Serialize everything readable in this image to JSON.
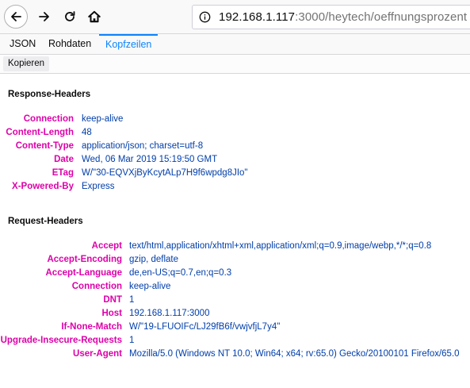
{
  "browser": {
    "url_host": "192.168.1.117",
    "url_rest": ":3000/heytech/oeffnungsprozent"
  },
  "viewer": {
    "tabs": [
      "JSON",
      "Rohdaten",
      "Kopfzeilen"
    ],
    "active_tab": "Kopfzeilen",
    "toolbar": {
      "copy_label": "Kopieren"
    }
  },
  "response_headers": {
    "title": "Response-Headers",
    "items": [
      {
        "name": "Connection",
        "value": "keep-alive"
      },
      {
        "name": "Content-Length",
        "value": "48"
      },
      {
        "name": "Content-Type",
        "value": "application/json; charset=utf-8"
      },
      {
        "name": "Date",
        "value": "Wed, 06 Mar 2019 15:19:50 GMT"
      },
      {
        "name": "ETag",
        "value": "W/\"30-EQVXjByKcytALp7H9f6wpdg8JIo\""
      },
      {
        "name": "X-Powered-By",
        "value": "Express"
      }
    ]
  },
  "request_headers": {
    "title": "Request-Headers",
    "items": [
      {
        "name": "Accept",
        "value": "text/html,application/xhtml+xml,application/xml;q=0.9,image/webp,*/*;q=0.8"
      },
      {
        "name": "Accept-Encoding",
        "value": "gzip, deflate"
      },
      {
        "name": "Accept-Language",
        "value": "de,en-US;q=0.7,en;q=0.3"
      },
      {
        "name": "Connection",
        "value": "keep-alive"
      },
      {
        "name": "DNT",
        "value": "1"
      },
      {
        "name": "Host",
        "value": "192.168.1.117:3000"
      },
      {
        "name": "If-None-Match",
        "value": "W/\"19-LFUOIFc/LJ29fB6f/vwjvfjL7y4\""
      },
      {
        "name": "Upgrade-Insecure-Requests",
        "value": "1"
      },
      {
        "name": "User-Agent",
        "value": "Mozilla/5.0 (Windows NT 10.0; Win64; x64; rv:65.0) Gecko/20100101 Firefox/65.0"
      }
    ]
  }
}
